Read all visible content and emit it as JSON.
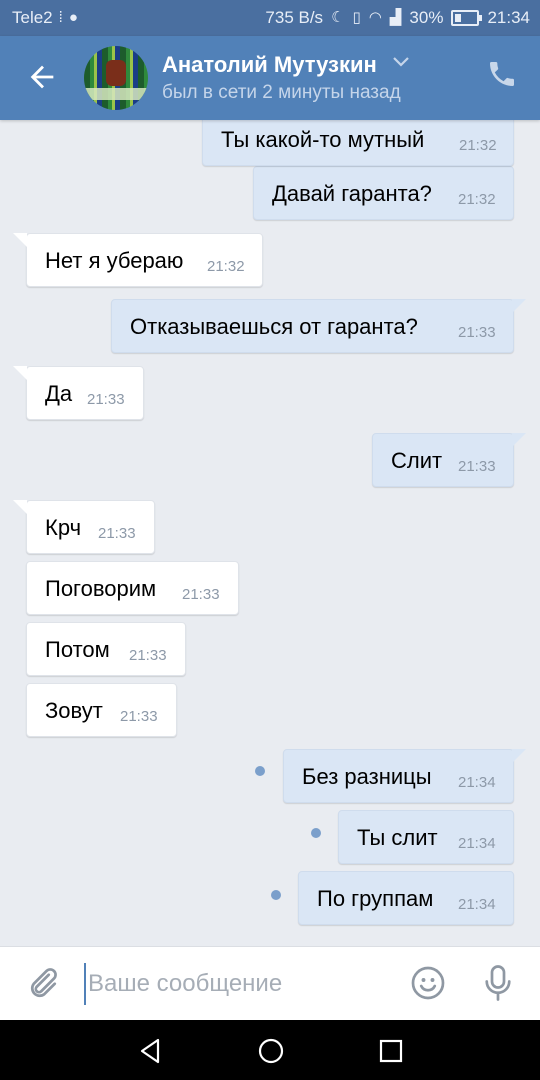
{
  "status_bar": {
    "carrier": "Tele2",
    "speed": "735 B/s",
    "battery": "30%",
    "time": "21:34"
  },
  "header": {
    "contact_name": "Анатолий Мутузкин",
    "last_seen": "был в сети 2 минуты назад"
  },
  "messages": [
    {
      "dir": "out",
      "text": "Ты какой-то мутный",
      "time": "21:32"
    },
    {
      "dir": "out",
      "text": "Давай гаранта?",
      "time": "21:32"
    },
    {
      "dir": "in",
      "text": "Нет я убераю",
      "time": "21:32"
    },
    {
      "dir": "out",
      "text": "Отказываешься от гаранта?",
      "time": "21:33"
    },
    {
      "dir": "in",
      "text": "Да",
      "time": "21:33"
    },
    {
      "dir": "out",
      "text": "Слит",
      "time": "21:33"
    },
    {
      "dir": "in",
      "text": "Крч",
      "time": "21:33"
    },
    {
      "dir": "in",
      "text": "Поговорим",
      "time": "21:33"
    },
    {
      "dir": "in",
      "text": "Потом",
      "time": "21:33"
    },
    {
      "dir": "in",
      "text": "Зовут",
      "time": "21:33"
    },
    {
      "dir": "out",
      "text": "Без разницы",
      "time": "21:34",
      "unread": true
    },
    {
      "dir": "out",
      "text": "Ты слит",
      "time": "21:34",
      "unread": true
    },
    {
      "dir": "out",
      "text": "По группам",
      "time": "21:34",
      "unread": true
    }
  ],
  "composer": {
    "placeholder": "Ваше сообщение",
    "value": ""
  },
  "colors": {
    "header": "#5181b8",
    "status_bar": "#4a6fa0",
    "outgoing_bubble": "#dae6f5",
    "incoming_bubble": "#ffffff",
    "chat_background": "#e9ecf1",
    "unread_dot": "#7b9fcb"
  },
  "icons": {
    "back": "arrow-left-icon",
    "dropdown": "chevron-down-icon",
    "call": "phone-icon",
    "attach": "paperclip-icon",
    "emoji": "smiley-icon",
    "voice": "microphone-icon",
    "nav": [
      "back-triangle-icon",
      "home-circle-icon",
      "recents-square-icon"
    ]
  }
}
